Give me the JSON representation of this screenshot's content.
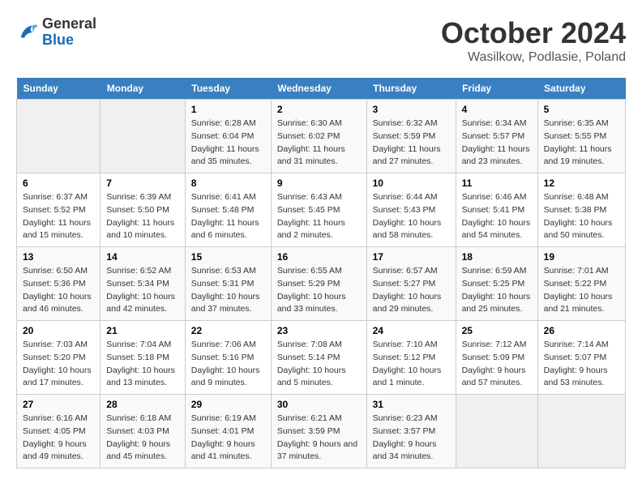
{
  "header": {
    "logo_general": "General",
    "logo_blue": "Blue",
    "main_title": "October 2024",
    "subtitle": "Wasilkow, Podlasie, Poland"
  },
  "columns": [
    "Sunday",
    "Monday",
    "Tuesday",
    "Wednesday",
    "Thursday",
    "Friday",
    "Saturday"
  ],
  "weeks": [
    [
      {
        "day": "",
        "sunrise": "",
        "sunset": "",
        "daylight": "",
        "empty": true
      },
      {
        "day": "",
        "sunrise": "",
        "sunset": "",
        "daylight": "",
        "empty": true
      },
      {
        "day": "1",
        "sunrise": "Sunrise: 6:28 AM",
        "sunset": "Sunset: 6:04 PM",
        "daylight": "Daylight: 11 hours and 35 minutes."
      },
      {
        "day": "2",
        "sunrise": "Sunrise: 6:30 AM",
        "sunset": "Sunset: 6:02 PM",
        "daylight": "Daylight: 11 hours and 31 minutes."
      },
      {
        "day": "3",
        "sunrise": "Sunrise: 6:32 AM",
        "sunset": "Sunset: 5:59 PM",
        "daylight": "Daylight: 11 hours and 27 minutes."
      },
      {
        "day": "4",
        "sunrise": "Sunrise: 6:34 AM",
        "sunset": "Sunset: 5:57 PM",
        "daylight": "Daylight: 11 hours and 23 minutes."
      },
      {
        "day": "5",
        "sunrise": "Sunrise: 6:35 AM",
        "sunset": "Sunset: 5:55 PM",
        "daylight": "Daylight: 11 hours and 19 minutes."
      }
    ],
    [
      {
        "day": "6",
        "sunrise": "Sunrise: 6:37 AM",
        "sunset": "Sunset: 5:52 PM",
        "daylight": "Daylight: 11 hours and 15 minutes."
      },
      {
        "day": "7",
        "sunrise": "Sunrise: 6:39 AM",
        "sunset": "Sunset: 5:50 PM",
        "daylight": "Daylight: 11 hours and 10 minutes."
      },
      {
        "day": "8",
        "sunrise": "Sunrise: 6:41 AM",
        "sunset": "Sunset: 5:48 PM",
        "daylight": "Daylight: 11 hours and 6 minutes."
      },
      {
        "day": "9",
        "sunrise": "Sunrise: 6:43 AM",
        "sunset": "Sunset: 5:45 PM",
        "daylight": "Daylight: 11 hours and 2 minutes."
      },
      {
        "day": "10",
        "sunrise": "Sunrise: 6:44 AM",
        "sunset": "Sunset: 5:43 PM",
        "daylight": "Daylight: 10 hours and 58 minutes."
      },
      {
        "day": "11",
        "sunrise": "Sunrise: 6:46 AM",
        "sunset": "Sunset: 5:41 PM",
        "daylight": "Daylight: 10 hours and 54 minutes."
      },
      {
        "day": "12",
        "sunrise": "Sunrise: 6:48 AM",
        "sunset": "Sunset: 5:38 PM",
        "daylight": "Daylight: 10 hours and 50 minutes."
      }
    ],
    [
      {
        "day": "13",
        "sunrise": "Sunrise: 6:50 AM",
        "sunset": "Sunset: 5:36 PM",
        "daylight": "Daylight: 10 hours and 46 minutes."
      },
      {
        "day": "14",
        "sunrise": "Sunrise: 6:52 AM",
        "sunset": "Sunset: 5:34 PM",
        "daylight": "Daylight: 10 hours and 42 minutes."
      },
      {
        "day": "15",
        "sunrise": "Sunrise: 6:53 AM",
        "sunset": "Sunset: 5:31 PM",
        "daylight": "Daylight: 10 hours and 37 minutes."
      },
      {
        "day": "16",
        "sunrise": "Sunrise: 6:55 AM",
        "sunset": "Sunset: 5:29 PM",
        "daylight": "Daylight: 10 hours and 33 minutes."
      },
      {
        "day": "17",
        "sunrise": "Sunrise: 6:57 AM",
        "sunset": "Sunset: 5:27 PM",
        "daylight": "Daylight: 10 hours and 29 minutes."
      },
      {
        "day": "18",
        "sunrise": "Sunrise: 6:59 AM",
        "sunset": "Sunset: 5:25 PM",
        "daylight": "Daylight: 10 hours and 25 minutes."
      },
      {
        "day": "19",
        "sunrise": "Sunrise: 7:01 AM",
        "sunset": "Sunset: 5:22 PM",
        "daylight": "Daylight: 10 hours and 21 minutes."
      }
    ],
    [
      {
        "day": "20",
        "sunrise": "Sunrise: 7:03 AM",
        "sunset": "Sunset: 5:20 PM",
        "daylight": "Daylight: 10 hours and 17 minutes."
      },
      {
        "day": "21",
        "sunrise": "Sunrise: 7:04 AM",
        "sunset": "Sunset: 5:18 PM",
        "daylight": "Daylight: 10 hours and 13 minutes."
      },
      {
        "day": "22",
        "sunrise": "Sunrise: 7:06 AM",
        "sunset": "Sunset: 5:16 PM",
        "daylight": "Daylight: 10 hours and 9 minutes."
      },
      {
        "day": "23",
        "sunrise": "Sunrise: 7:08 AM",
        "sunset": "Sunset: 5:14 PM",
        "daylight": "Daylight: 10 hours and 5 minutes."
      },
      {
        "day": "24",
        "sunrise": "Sunrise: 7:10 AM",
        "sunset": "Sunset: 5:12 PM",
        "daylight": "Daylight: 10 hours and 1 minute."
      },
      {
        "day": "25",
        "sunrise": "Sunrise: 7:12 AM",
        "sunset": "Sunset: 5:09 PM",
        "daylight": "Daylight: 9 hours and 57 minutes."
      },
      {
        "day": "26",
        "sunrise": "Sunrise: 7:14 AM",
        "sunset": "Sunset: 5:07 PM",
        "daylight": "Daylight: 9 hours and 53 minutes."
      }
    ],
    [
      {
        "day": "27",
        "sunrise": "Sunrise: 6:16 AM",
        "sunset": "Sunset: 4:05 PM",
        "daylight": "Daylight: 9 hours and 49 minutes."
      },
      {
        "day": "28",
        "sunrise": "Sunrise: 6:18 AM",
        "sunset": "Sunset: 4:03 PM",
        "daylight": "Daylight: 9 hours and 45 minutes."
      },
      {
        "day": "29",
        "sunrise": "Sunrise: 6:19 AM",
        "sunset": "Sunset: 4:01 PM",
        "daylight": "Daylight: 9 hours and 41 minutes."
      },
      {
        "day": "30",
        "sunrise": "Sunrise: 6:21 AM",
        "sunset": "Sunset: 3:59 PM",
        "daylight": "Daylight: 9 hours and 37 minutes."
      },
      {
        "day": "31",
        "sunrise": "Sunrise: 6:23 AM",
        "sunset": "Sunset: 3:57 PM",
        "daylight": "Daylight: 9 hours and 34 minutes."
      },
      {
        "day": "",
        "sunrise": "",
        "sunset": "",
        "daylight": "",
        "empty": true
      },
      {
        "day": "",
        "sunrise": "",
        "sunset": "",
        "daylight": "",
        "empty": true
      }
    ]
  ]
}
